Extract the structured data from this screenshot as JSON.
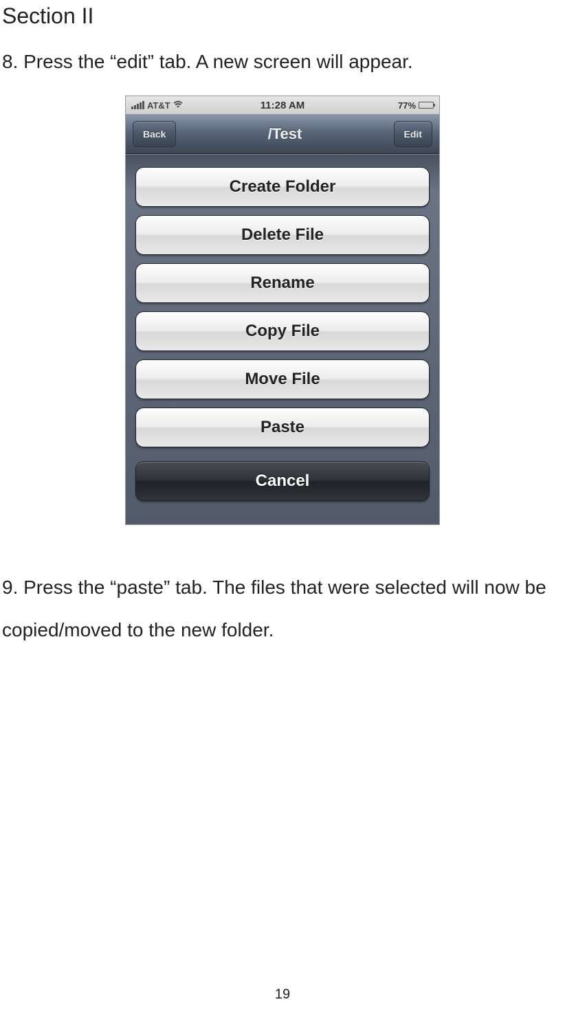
{
  "section_title": "Section II",
  "step8": "8. Press the “edit” tab. A new screen will appear.",
  "step9": "9. Press the “paste” tab. The files that were selected will now be copied/moved to the new folder.",
  "page_number": "19",
  "phone": {
    "status": {
      "carrier": "AT&T",
      "time": "11:28 AM",
      "battery_pct": "77%"
    },
    "nav": {
      "back": "Back",
      "title": "/Test",
      "edit": "Edit"
    },
    "actions": {
      "create_folder": "Create Folder",
      "delete_file": "Delete File",
      "rename": "Rename",
      "copy_file": "Copy File",
      "move_file": "Move File",
      "paste": "Paste",
      "cancel": "Cancel"
    }
  }
}
